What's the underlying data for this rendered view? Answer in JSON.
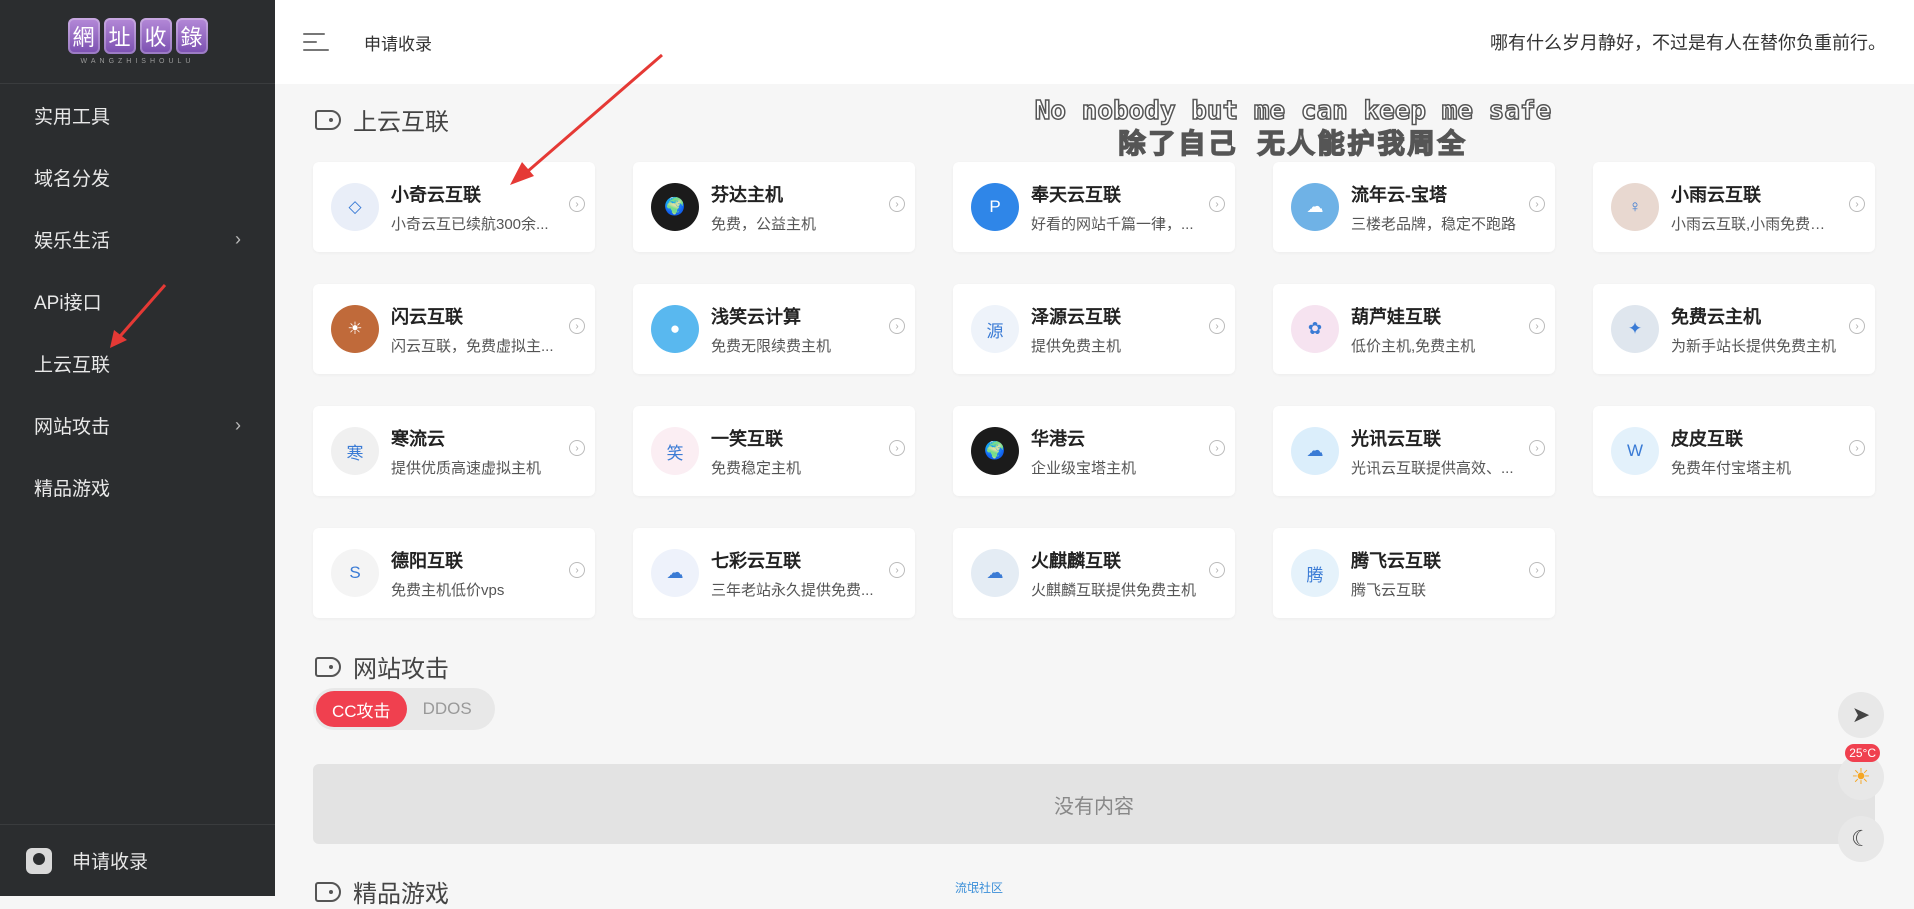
{
  "sidebar": {
    "logo_chars": [
      "網",
      "址",
      "收",
      "錄"
    ],
    "logo_sub": "WANGZHISHOULU",
    "items": [
      {
        "label": "实用工具",
        "has_chevron": false
      },
      {
        "label": "域名分发",
        "has_chevron": false
      },
      {
        "label": "娱乐生活",
        "has_chevron": true
      },
      {
        "label": "APi接口",
        "has_chevron": false
      },
      {
        "label": "上云互联",
        "has_chevron": false
      },
      {
        "label": "网站攻击",
        "has_chevron": true
      },
      {
        "label": "精品游戏",
        "has_chevron": false
      }
    ],
    "bottom_label": "申请收录"
  },
  "header": {
    "link": "申请收录",
    "quote": "哪有什么岁月静好，不过是有人在替你负重前行。"
  },
  "overlay": {
    "line1": "No nobody but me can keep me safe",
    "line2": "除了自己 无人能护我周全"
  },
  "sections": {
    "cloud": {
      "title": "上云互联",
      "cards": [
        {
          "name": "小奇云互联",
          "desc": "小奇云互已续航300余...",
          "icon_color": "#e9eef8",
          "icon_text": "◇"
        },
        {
          "name": "芬达主机",
          "desc": "免费，公益主机",
          "icon_color": "#1b1b1b",
          "icon_text": "🌍"
        },
        {
          "name": "奉天云互联",
          "desc": "好看的网站千篇一律，...",
          "icon_color": "#2f86e8",
          "icon_text": "P"
        },
        {
          "name": "流年云-宝塔",
          "desc": "三楼老品牌，稳定不跑路",
          "icon_color": "#6fb2e6",
          "icon_text": "☁"
        },
        {
          "name": "小雨云互联",
          "desc": "小雨云互联,小雨免费主...",
          "icon_color": "#e8d8d0",
          "icon_text": "♀"
        },
        {
          "name": "闪云互联",
          "desc": "闪云互联，免费虚拟主...",
          "icon_color": "#c06a3a",
          "icon_text": "☀"
        },
        {
          "name": "浅笑云计算",
          "desc": "免费无限续费主机",
          "icon_color": "#59b8ef",
          "icon_text": "●"
        },
        {
          "name": "泽源云互联",
          "desc": "提供免费主机",
          "icon_color": "#eef3fa",
          "icon_text": "源"
        },
        {
          "name": "葫芦娃互联",
          "desc": "低价主机,免费主机",
          "icon_color": "#f6e3f0",
          "icon_text": "✿"
        },
        {
          "name": "免费云主机",
          "desc": "为新手站长提供免费主机",
          "icon_color": "#dfe6ee",
          "icon_text": "✦"
        },
        {
          "name": "寒流云",
          "desc": "提供优质高速虚拟主机",
          "icon_color": "#f0f0f0",
          "icon_text": "寒"
        },
        {
          "name": "一笑互联",
          "desc": "免费稳定主机",
          "icon_color": "#fbeef3",
          "icon_text": "笑"
        },
        {
          "name": "华港云",
          "desc": "企业级宝塔主机",
          "icon_color": "#1b1b1b",
          "icon_text": "🌍"
        },
        {
          "name": "光讯云互联",
          "desc": "光讯云互联提供高效、...",
          "icon_color": "#dbeefb",
          "icon_text": "☁"
        },
        {
          "name": "皮皮互联",
          "desc": "免费年付宝塔主机",
          "icon_color": "#e3f1fb",
          "icon_text": "W"
        },
        {
          "name": "德阳互联",
          "desc": "免费主机低价vps",
          "icon_color": "#f4f4f4",
          "icon_text": "S"
        },
        {
          "name": "七彩云互联",
          "desc": "三年老站永久提供免费...",
          "icon_color": "#eef2fb",
          "icon_text": "☁"
        },
        {
          "name": "火麒麟互联",
          "desc": "火麒麟互联提供免费主机",
          "icon_color": "#e4ecf4",
          "icon_text": "☁"
        },
        {
          "name": "腾飞云互联",
          "desc": "腾飞云互联",
          "icon_color": "#e5f2fb",
          "icon_text": "腾"
        }
      ]
    },
    "attack": {
      "title": "网站攻击",
      "tabs": [
        {
          "label": "CC攻击",
          "active": true
        },
        {
          "label": "DDOS",
          "active": false
        }
      ],
      "empty_text": "没有内容"
    },
    "games": {
      "title": "精品游戏"
    }
  },
  "floating": {
    "temperature": "25°C"
  },
  "footer_mini": "流氓社区"
}
